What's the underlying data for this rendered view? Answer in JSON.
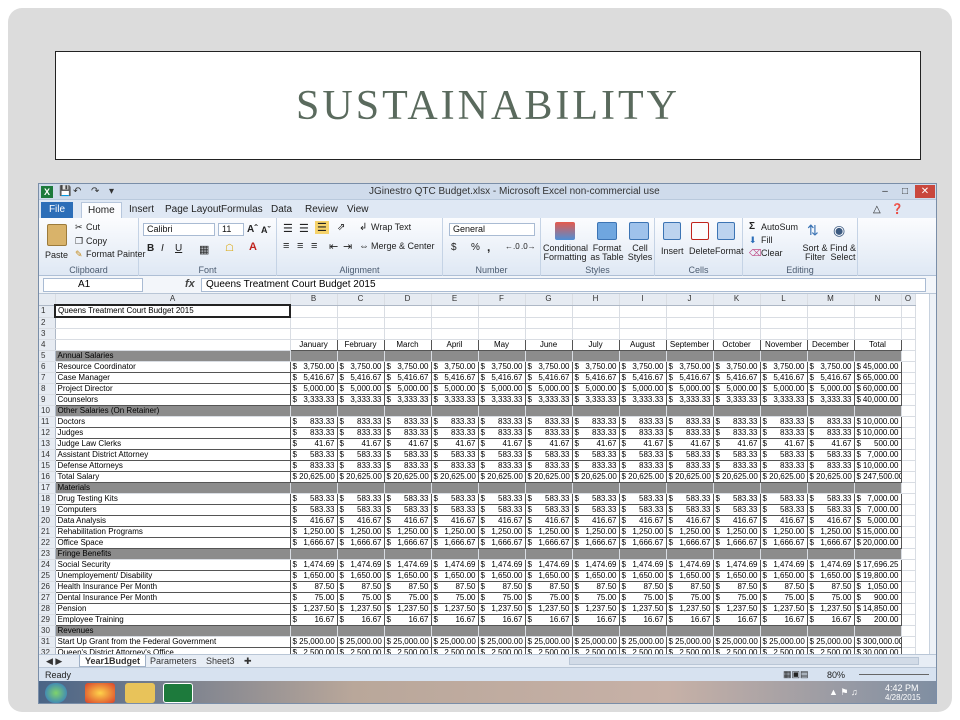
{
  "slide": {
    "title": "SUSTAINABILITY"
  },
  "window": {
    "app_icon": "X",
    "title": "JGinestro QTC Budget.xlsx - Microsoft Excel non-commercial use",
    "min": "–",
    "max": "□",
    "close": "✕"
  },
  "ribbon": {
    "tabs": [
      "File",
      "Home",
      "Insert",
      "Page Layout",
      "Formulas",
      "Data",
      "Review",
      "View"
    ],
    "clipboard": {
      "paste": "Paste",
      "cut": "Cut",
      "copy": "Copy",
      "format_painter": "Format Painter",
      "label": "Clipboard"
    },
    "font": {
      "name": "Calibri",
      "size": "11",
      "bold": "B",
      "italic": "I",
      "underline": "U",
      "label": "Font"
    },
    "alignment": {
      "wrap": "Wrap Text",
      "merge": "Merge & Center",
      "label": "Alignment"
    },
    "number": {
      "format": "General",
      "currency": "$",
      "percent": "%",
      "comma": ",",
      "label": "Number"
    },
    "styles": {
      "cond": "Conditional Formatting",
      "table": "Format as Table",
      "cell": "Cell Styles",
      "label": "Styles"
    },
    "cells": {
      "insert": "Insert",
      "delete": "Delete",
      "format": "Format",
      "label": "Cells"
    },
    "editing": {
      "autosum": "AutoSum",
      "fill": "Fill",
      "clear": "Clear",
      "sort": "Sort & Filter",
      "find": "Find & Select",
      "label": "Editing"
    }
  },
  "formula_bar": {
    "cell": "A1",
    "fx": "fx",
    "content": "Queens Treatment Court Budget 2015"
  },
  "sheet": {
    "columns": [
      "A",
      "B",
      "C",
      "D",
      "E",
      "F",
      "G",
      "H",
      "I",
      "J",
      "K",
      "L",
      "M",
      "N",
      "O"
    ],
    "months": [
      "January",
      "February",
      "March",
      "April",
      "May",
      "June",
      "July",
      "August",
      "September",
      "October",
      "November",
      "December",
      "Total"
    ],
    "rows": [
      {
        "n": "1",
        "label": "Queens Treatment Court Budget 2015"
      },
      {
        "n": "2",
        "label": ""
      },
      {
        "n": "3",
        "label": ""
      },
      {
        "n": "4",
        "label": "",
        "months": true
      },
      {
        "n": "5",
        "label": "Annual Salaries",
        "section": true
      },
      {
        "n": "6",
        "label": "Resource Coordinator",
        "v": "3,750.00",
        "t": "45,000.00"
      },
      {
        "n": "7",
        "label": "Case Manager",
        "v": "5,416.67",
        "t": "65,000.00"
      },
      {
        "n": "8",
        "label": "Project Director",
        "v": "5,000.00",
        "t": "60,000.00"
      },
      {
        "n": "9",
        "label": "Counselors",
        "v": "3,333.33",
        "t": "40,000.00"
      },
      {
        "n": "10",
        "label": "Other Salaries (On Retainer)",
        "section": true
      },
      {
        "n": "11",
        "label": "Doctors",
        "v": "833.33",
        "t": "10,000.00"
      },
      {
        "n": "12",
        "label": "Judges",
        "v": "833.33",
        "t": "10,000.00"
      },
      {
        "n": "13",
        "label": "Judge Law Clerks",
        "v": "41.67",
        "t": "500.00"
      },
      {
        "n": "14",
        "label": "Assistant District Attorney",
        "v": "583.33",
        "t": "7,000.00"
      },
      {
        "n": "15",
        "label": "Defense Attorneys",
        "v": "833.33",
        "t": "10,000.00"
      },
      {
        "n": "16",
        "label": "Total Salary",
        "v": "20,625.00",
        "t": "247,500.00",
        "tight": true
      },
      {
        "n": "17",
        "label": "Materials",
        "section": true
      },
      {
        "n": "18",
        "label": "Drug Testing Kits",
        "v": "583.33",
        "t": "7,000.00"
      },
      {
        "n": "19",
        "label": "Computers",
        "v": "583.33",
        "t": "7,000.00"
      },
      {
        "n": "20",
        "label": "Data Analysis",
        "v": "416.67",
        "t": "5,000.00"
      },
      {
        "n": "21",
        "label": "Rehabilitation Programs",
        "v": "1,250.00",
        "t": "15,000.00"
      },
      {
        "n": "22",
        "label": "Office Space",
        "v": "1,666.67",
        "t": "20,000.00"
      },
      {
        "n": "23",
        "label": "Fringe Benefits",
        "section": true
      },
      {
        "n": "24",
        "label": "Social Security",
        "v": "1,474.69",
        "t": "17,696.25"
      },
      {
        "n": "25",
        "label": "Unemployement/ Disability",
        "v": "1,650.00",
        "t": "19,800.00"
      },
      {
        "n": "26",
        "label": "Health Insurance Per Month",
        "v": "87.50",
        "t": "1,050.00"
      },
      {
        "n": "27",
        "label": "Dental Insurance Per Month",
        "v": "75.00",
        "t": "900.00"
      },
      {
        "n": "28",
        "label": "Pension",
        "v": "1,237.50",
        "t": "14,850.00"
      },
      {
        "n": "29",
        "label": "Employee Training",
        "v": "16.67",
        "t": "200.00"
      },
      {
        "n": "30",
        "label": "Revenues",
        "section": true
      },
      {
        "n": "31",
        "label": "Start Up Grant from the Federal Government",
        "v": "25,000.00",
        "t": "300,000.00",
        "tight": true
      },
      {
        "n": "32",
        "label": "Queen's District Attorney's Office",
        "v": "2,500.00",
        "t": "30,000.00"
      }
    ],
    "tabs": [
      "Year1Budget",
      "Parameters",
      "Sheet3"
    ]
  },
  "status": {
    "ready": "Ready",
    "zoom": "80%"
  },
  "taskbar": {
    "time": "4:42 PM",
    "date": "4/28/2015"
  }
}
